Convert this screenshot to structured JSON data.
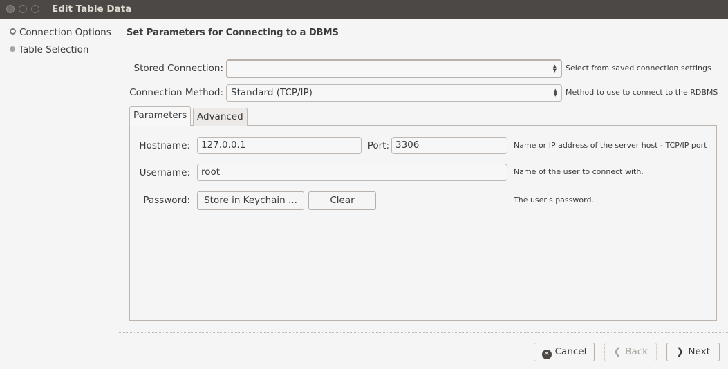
{
  "window": {
    "title": "Edit Table Data"
  },
  "sidebar": {
    "items": [
      {
        "label": "Connection Options",
        "active": true
      },
      {
        "label": "Table Selection",
        "active": false
      }
    ]
  },
  "main": {
    "heading": "Set Parameters for Connecting to a DBMS",
    "stored_connection": {
      "label": "Stored Connection:",
      "value": "",
      "hint": "Select from saved connection settings"
    },
    "connection_method": {
      "label": "Connection Method:",
      "value": "Standard (TCP/IP)",
      "hint": "Method to use to connect to the RDBMS"
    },
    "tabs": [
      {
        "label": "Parameters"
      },
      {
        "label": "Advanced"
      }
    ],
    "params": {
      "hostname": {
        "label": "Hostname:",
        "value": "127.0.0.1"
      },
      "port": {
        "label": "Port:",
        "value": "3306"
      },
      "host_hint": "Name or IP address of the server host - TCP/IP port",
      "username": {
        "label": "Username:",
        "value": "root",
        "hint": "Name of the user to connect with."
      },
      "password": {
        "label": "Password:",
        "store_label": "Store in Keychain ...",
        "clear_label": "Clear",
        "hint": "The user's password."
      }
    }
  },
  "footer": {
    "cancel_label": "Cancel",
    "back_label": "Back",
    "next_label": "Next"
  },
  "icons": {
    "cancel": "✕",
    "back": "❮",
    "next": "❯"
  }
}
